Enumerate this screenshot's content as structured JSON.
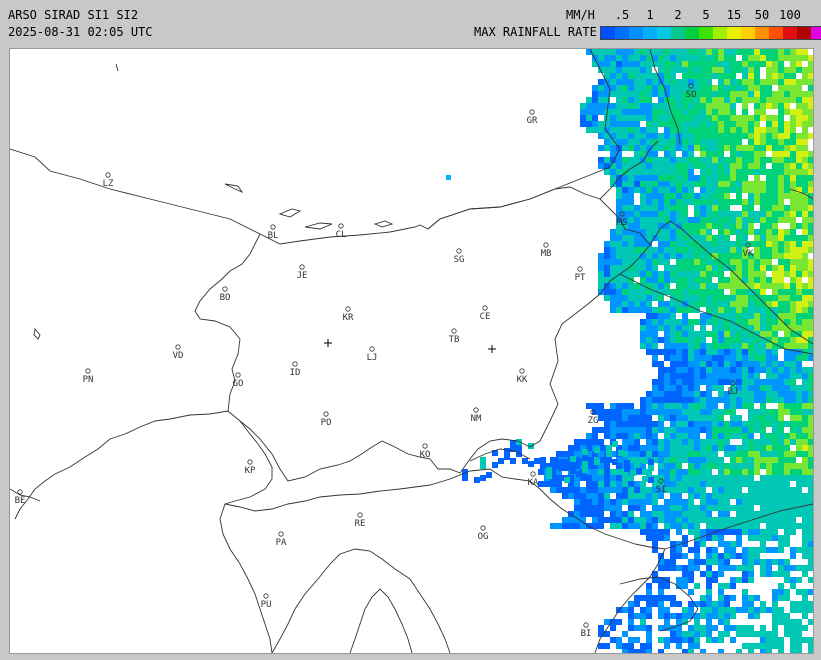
{
  "header": {
    "title": "ARSO SIRAD SI1 SI2",
    "timestamp": "2025-08-31 02:05 UTC",
    "unit": "MM/H",
    "legend_label": "MAX RAINFALL RATE",
    "ticks": [
      ".5",
      "1",
      "2",
      "5",
      "15",
      "50",
      "100"
    ]
  },
  "colors": {
    "scale": [
      "#0050ff",
      "#0070ff",
      "#0090ff",
      "#00b0ff",
      "#00c8e0",
      "#00c890",
      "#00d040",
      "#40e000",
      "#a0f000",
      "#e8f000",
      "#ffd000",
      "#ff9000",
      "#ff5000",
      "#e01010",
      "#b00000",
      "#e000e0"
    ],
    "rain_low": "#0064ff",
    "rain_mid": "#00c8b4",
    "rain_high": "#78e632",
    "rain_peak": "#d2f014",
    "background": "#ffffff",
    "boundary": "#333333"
  },
  "map": {
    "cities": [
      {
        "name": "GR"
      },
      {
        "name": "SO"
      },
      {
        "name": "LZ"
      },
      {
        "name": "BL"
      },
      {
        "name": "CL"
      },
      {
        "name": "MB"
      },
      {
        "name": "MS"
      },
      {
        "name": "VK"
      },
      {
        "name": "JE"
      },
      {
        "name": "SG"
      },
      {
        "name": "PT"
      },
      {
        "name": "BO"
      },
      {
        "name": "KR"
      },
      {
        "name": "CE"
      },
      {
        "name": "VD"
      },
      {
        "name": "LJ"
      },
      {
        "name": "TB"
      },
      {
        "name": "PN"
      },
      {
        "name": "GO"
      },
      {
        "name": "ID"
      },
      {
        "name": "KK"
      },
      {
        "name": "NM"
      },
      {
        "name": "BJ"
      },
      {
        "name": "PO"
      },
      {
        "name": "ZG"
      },
      {
        "name": "KO"
      },
      {
        "name": "KP"
      },
      {
        "name": "KA"
      },
      {
        "name": "BE"
      },
      {
        "name": "RE"
      },
      {
        "name": "PA"
      },
      {
        "name": "OG"
      },
      {
        "name": "PU"
      },
      {
        "name": "BI"
      },
      {
        "name": "SI"
      }
    ]
  }
}
